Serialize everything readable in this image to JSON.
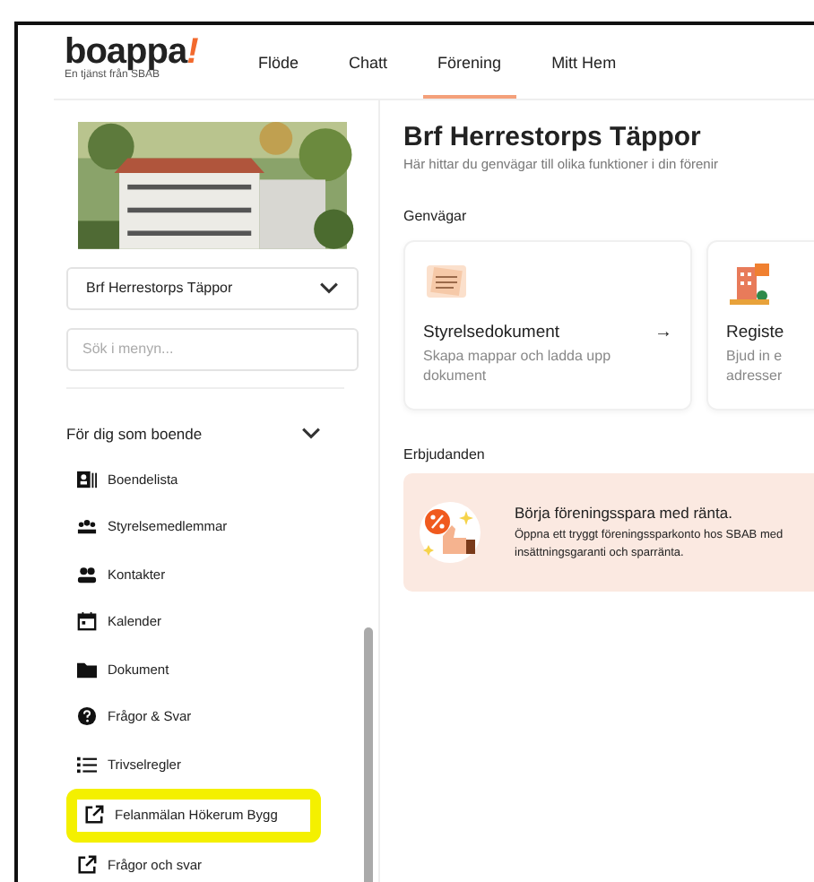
{
  "logo": {
    "name": "boappa",
    "mark": "!",
    "tagline": "En tjänst från SBAB"
  },
  "nav": [
    {
      "label": "Flöde",
      "selected": false
    },
    {
      "label": "Chatt",
      "selected": false
    },
    {
      "label": "Förening",
      "selected": true
    },
    {
      "label": "Mitt Hem",
      "selected": false
    }
  ],
  "sidebar": {
    "association_select": {
      "value": "Brf Herrestorps Täppor"
    },
    "search": {
      "placeholder": "Sök i menyn..."
    },
    "section": {
      "title": "För dig som boende",
      "expanded": true,
      "items": [
        {
          "label": "Boendelista",
          "highlighted": false
        },
        {
          "label": "Styrelsemedlemmar",
          "highlighted": false
        },
        {
          "label": "Kontakter",
          "highlighted": false
        },
        {
          "label": "Kalender",
          "highlighted": false
        },
        {
          "label": "Dokument",
          "highlighted": false
        },
        {
          "label": "Frågor & Svar",
          "highlighted": false
        },
        {
          "label": "Trivselregler",
          "highlighted": false
        },
        {
          "label": "Felanmälan Hökerum Bygg",
          "highlighted": true
        },
        {
          "label": "Frågor och svar",
          "highlighted": false
        }
      ]
    }
  },
  "main": {
    "title": "Brf Herrestorps Täppor",
    "subtitle": "Här hittar du genvägar till olika funktioner i din förenir",
    "shortcuts_title": "Genvägar",
    "shortcuts": [
      {
        "title": "Styrelsedokument",
        "description": [
          "Skapa mappar och ladda upp",
          "dokument"
        ],
        "arrow": "→"
      },
      {
        "title": "Registe",
        "description": [
          "Bjud in e",
          "adresser"
        ]
      }
    ],
    "offers_title": "Erbjudanden",
    "offer": {
      "title": "Börja föreningsspara med ränta.",
      "text": "Öppna ett tryggt föreningssparkonto hos SBAB med insättningsgaranti och sparränta."
    }
  }
}
